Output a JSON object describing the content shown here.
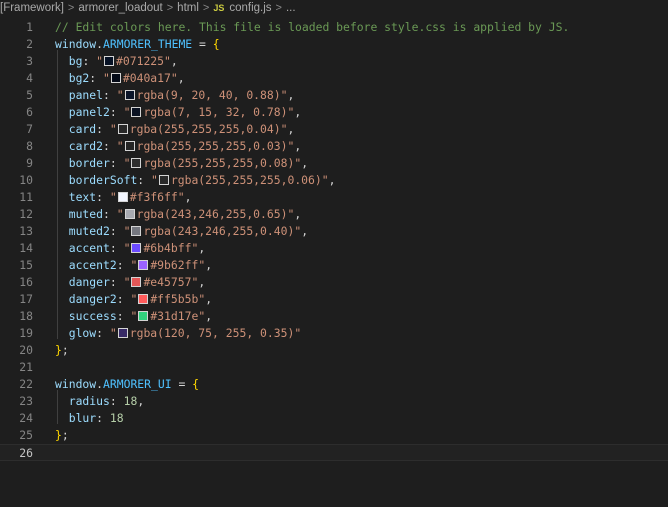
{
  "breadcrumb": {
    "items": [
      "[Framework]",
      "armorer_loadout",
      "html",
      "config.js",
      "..."
    ],
    "file_badge": "JS",
    "separator": ">"
  },
  "editor": {
    "current_line": 26,
    "line_numbers": [
      "1",
      "2",
      "3",
      "4",
      "5",
      "6",
      "7",
      "8",
      "9",
      "10",
      "11",
      "12",
      "13",
      "14",
      "15",
      "16",
      "17",
      "18",
      "19",
      "20",
      "21",
      "22",
      "23",
      "24",
      "25",
      "26"
    ],
    "comment": "// Edit colors here. This file is loaded before style.css is applied by JS.",
    "theme_object": "window",
    "theme_name": "ARMORER_THEME",
    "ui_object": "window",
    "ui_name": "ARMORER_UI",
    "theme_entries": [
      {
        "key": "bg",
        "value": "#071225",
        "swatch": "#071225"
      },
      {
        "key": "bg2",
        "value": "#040a17",
        "swatch": "#040a17"
      },
      {
        "key": "panel",
        "value": "rgba(9, 20, 40, 0.88)",
        "swatch": "#0b1529"
      },
      {
        "key": "panel2",
        "value": "rgba(7, 15, 32, 0.78)",
        "swatch": "#0a1222"
      },
      {
        "key": "card",
        "value": "rgba(255,255,255,0.04)",
        "swatch": "#282828"
      },
      {
        "key": "card2",
        "value": "rgba(255,255,255,0.03)",
        "swatch": "#252525"
      },
      {
        "key": "border",
        "value": "rgba(255,255,255,0.08)",
        "swatch": "#2e2e2e"
      },
      {
        "key": "borderSoft",
        "value": "rgba(255,255,255,0.06)",
        "swatch": "#2a2a2a"
      },
      {
        "key": "text",
        "value": "#f3f6ff",
        "swatch": "#f3f6ff"
      },
      {
        "key": "muted",
        "value": "rgba(243,246,255,0.65)",
        "swatch": "#a8aab1"
      },
      {
        "key": "muted2",
        "value": "rgba(243,246,255,0.40)",
        "swatch": "#767880"
      },
      {
        "key": "accent",
        "value": "#6b4bff",
        "swatch": "#6b4bff"
      },
      {
        "key": "accent2",
        "value": "#9b62ff",
        "swatch": "#9b62ff"
      },
      {
        "key": "danger",
        "value": "#e45757",
        "swatch": "#e45757"
      },
      {
        "key": "danger2",
        "value": "#ff5b5b",
        "swatch": "#ff5b5b"
      },
      {
        "key": "success",
        "value": "#31d17e",
        "swatch": "#31d17e"
      },
      {
        "key": "glow",
        "value": "rgba(120, 75, 255, 0.35)",
        "swatch": "#372a66"
      }
    ],
    "ui_entries": [
      {
        "key": "radius",
        "value": "18"
      },
      {
        "key": "blur",
        "value": "18"
      }
    ]
  },
  "colors": {
    "background": "#1e1e1e",
    "comment": "#6a9955",
    "string": "#ce9178",
    "number": "#b5cea8",
    "property": "#9cdcfe",
    "constant": "#4fc1ff",
    "bracket": "#ffd700"
  }
}
